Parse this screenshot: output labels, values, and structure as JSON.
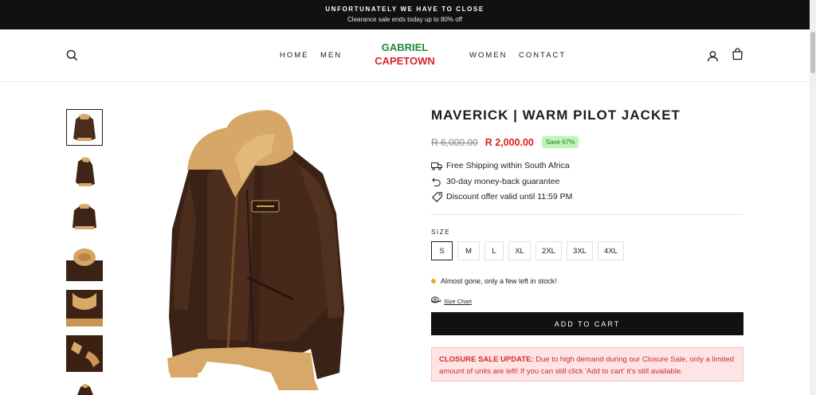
{
  "announcement": {
    "line1": "UNFORTUNATELY WE HAVE TO CLOSE",
    "line2": "Clearance sale ends today up to 80% off"
  },
  "header": {
    "logo_line1": "GABRIEL",
    "logo_line2": "CAPETOWN",
    "nav": [
      "HOME",
      "MEN",
      "WOMEN",
      "CONTACT"
    ],
    "icons": [
      "search-icon",
      "account-icon",
      "cart-icon"
    ]
  },
  "product": {
    "title": "MAVERICK | WARM PILOT JACKET",
    "old_price": "R 6,000.00",
    "price": "R 2,000.00",
    "save_badge": "Save 67%",
    "perks": [
      "Free Shipping within South Africa",
      "30-day money-back guarantee",
      "Discount offer valid until 11:59 PM"
    ],
    "size_label": "SIZE",
    "sizes": [
      "S",
      "M",
      "L",
      "XL",
      "2XL",
      "3XL",
      "4XL"
    ],
    "selected_size": "S",
    "stock_text": "Almost gone, only a few left in stock!",
    "size_chart": "Size Chart",
    "add_to_cart": "ADD TO CART",
    "notice_bold": "CLOSURE SALE UPDATE:",
    "notice_text": " Due to high demand during our Closure Sale, only a limited amount of units are left! If you can still click 'Add to cart' it's still available."
  },
  "colors": {
    "announcement_bg": "#111111",
    "sale_price": "#e01b23",
    "save_badge_bg": "#bdf5b8",
    "logo_green": "#1e8a3c",
    "logo_red": "#d9232b",
    "notice_bg": "#fde5e5"
  }
}
